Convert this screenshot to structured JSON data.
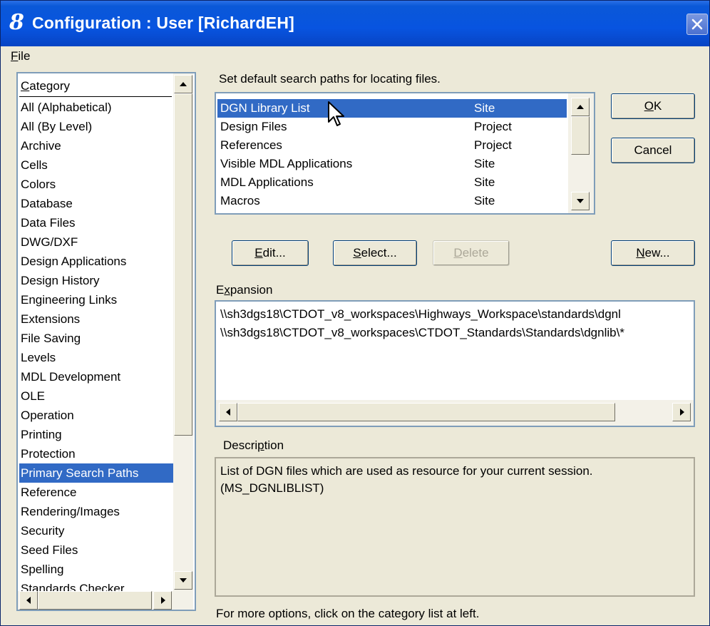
{
  "window": {
    "title": "Configuration : User [RichardEH]",
    "app_icon_glyph": "8",
    "accent": "#0854e0"
  },
  "menu": {
    "file_label_prefix": "F",
    "file_label_rest": "ile"
  },
  "category_list": {
    "header_prefix": "C",
    "header_rest": "ategory",
    "items": [
      "All (Alphabetical)",
      "All (By Level)",
      "Archive",
      "Cells",
      "Colors",
      "Database",
      "Data Files",
      "DWG/DXF",
      "Design Applications",
      "Design History",
      "Engineering Links",
      "Extensions",
      "File Saving",
      "Levels",
      "MDL Development",
      "OLE",
      "Operation",
      "Printing",
      "Protection",
      "Primary Search Paths",
      "Reference",
      "Rendering/Images",
      "Security",
      "Seed Files",
      "Spelling",
      "Standards Checker"
    ],
    "selected": "Primary Search Paths"
  },
  "main": {
    "instruction": "Set default search paths for locating files.",
    "paths": [
      {
        "name": "DGN Library List",
        "level": "Site"
      },
      {
        "name": "Design Files",
        "level": "Project"
      },
      {
        "name": "References",
        "level": "Project"
      },
      {
        "name": "Visible MDL Applications",
        "level": "Site"
      },
      {
        "name": "MDL Applications",
        "level": "Site"
      },
      {
        "name": "Macros",
        "level": "Site"
      }
    ],
    "selected_path": "DGN Library List"
  },
  "buttons": {
    "ok": {
      "prefix": "O",
      "rest": "K"
    },
    "cancel": "Cancel",
    "edit": {
      "prefix": "E",
      "rest": "dit..."
    },
    "select": {
      "prefix": "S",
      "rest": "elect..."
    },
    "delete": {
      "prefix": "D",
      "rest": "elete"
    },
    "new": {
      "prefix": "N",
      "rest": "ew..."
    }
  },
  "expansion": {
    "label_prefix": "E",
    "label_u": "x",
    "label_rest": "pansion",
    "lines": [
      "\\\\sh3dgs18\\CTDOT_v8_workspaces\\Highways_Workspace\\standards\\dgnl",
      "\\\\sh3dgs18\\CTDOT_v8_workspaces\\CTDOT_Standards\\Standards\\dgnlib\\*"
    ]
  },
  "description": {
    "label_prefix": "Descri",
    "label_u": "p",
    "label_rest": "tion",
    "lines": [
      "List of DGN files which are used as resource for your current session.",
      "(MS_DGNLIBLIST)"
    ]
  },
  "footer_hint": "For more options, click on the category list at left."
}
